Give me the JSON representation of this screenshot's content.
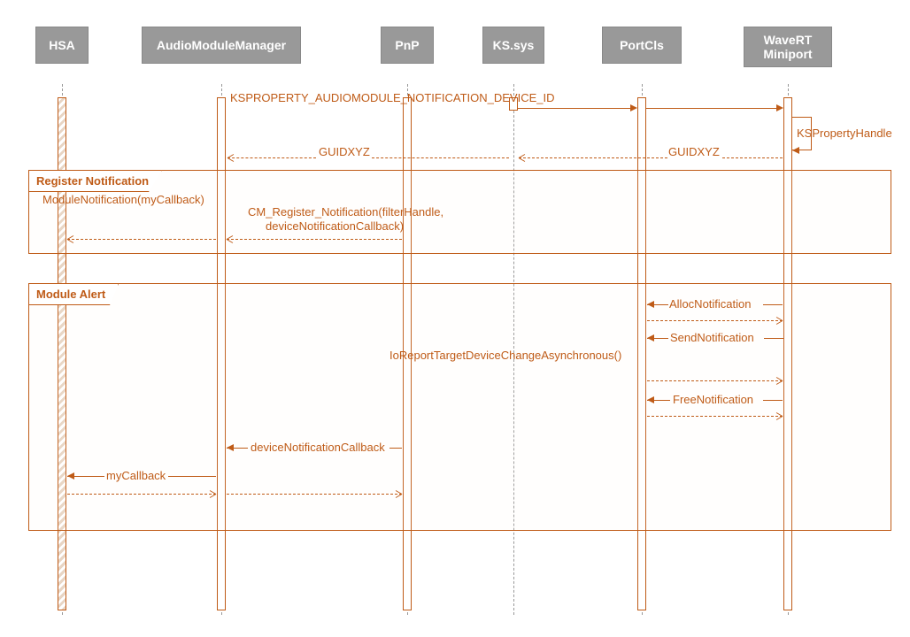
{
  "participants": {
    "hsa": "HSA",
    "amm": "AudioModuleManager",
    "pnp": "PnP",
    "ks": "KS.sys",
    "portcls": "PortCls",
    "wavert": "WaveRT\nMiniport"
  },
  "messages": {
    "ksproperty": "KSPROPERTY_AUDIOMODULE_NOTIFICATION_DEVICE_ID",
    "kspropertyhandle": "KSPropertyHandle",
    "guidxyz1": "GUIDXYZ",
    "guidxyz2": "GUIDXYZ",
    "modulenotif": "ModuleNotification(myCallback)",
    "cmregister1": "CM_Register_Notification(filterHandle,",
    "cmregister2": "deviceNotificationCallback)",
    "allocnotif": "AllocNotification",
    "sendnotif": "SendNotification",
    "ioreport": "IoReportTargetDeviceChangeAsynchronous()",
    "freenotif": "FreeNotification",
    "devicecb": "deviceNotificationCallback",
    "mycallback": "myCallback"
  },
  "frames": {
    "register": "Register Notification",
    "alert": "Module Alert"
  }
}
